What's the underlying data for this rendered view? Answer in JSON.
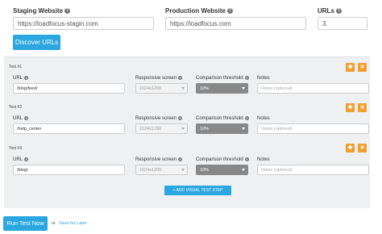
{
  "form": {
    "staging": {
      "label": "Staging Website",
      "value": "https://loadfocus-stagin.com"
    },
    "production": {
      "label": "Production Website",
      "value": "https://loadfocus.com"
    },
    "urls": {
      "label": "URLs",
      "value": "3."
    },
    "help_glyph": "?"
  },
  "discover_button": "Discover URLs",
  "tests": [
    {
      "title": "Test #1",
      "url": "/blog/feed/",
      "screen": "1024x1200",
      "threshold": "10%",
      "notes_placeholder": "Notes (optional)"
    },
    {
      "title": "Test #2",
      "url": "/help_center",
      "screen": "1024x1200",
      "threshold": "10%",
      "notes_placeholder": "Notes (optional)"
    },
    {
      "title": "Test #3",
      "url": "/blog/",
      "screen": "1024x1200",
      "threshold": "10%",
      "notes_placeholder": "Notes (optional)"
    }
  ],
  "field_labels": {
    "url": "URL",
    "screen": "Responsive screen",
    "threshold": "Comparison threshold",
    "notes": "Notes"
  },
  "test_actions": {
    "move": "✥",
    "remove": "✕"
  },
  "add_step_button": "+ ADD VISUAL TEST STEP",
  "footer": {
    "run_button": "Run Test Now",
    "or_text": "or",
    "save_link": "Save for Later"
  },
  "colors": {
    "accent": "#2aa6e0",
    "orange": "#f0a030",
    "panel": "#eef0f2"
  }
}
